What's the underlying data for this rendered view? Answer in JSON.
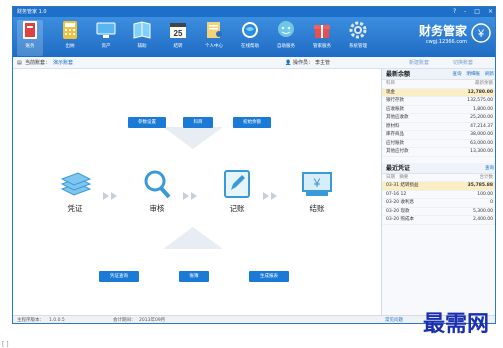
{
  "window": {
    "title": "财务管家 1.0",
    "controls": [
      "?",
      "-",
      "□",
      "×"
    ]
  },
  "toolbar": {
    "items": [
      {
        "label": "账务",
        "icon": "ledger-icon",
        "color": "#e04040"
      },
      {
        "label": "出纳",
        "icon": "calculator-icon",
        "color": "#f0c040"
      },
      {
        "label": "资产",
        "icon": "monitor-icon",
        "color": "#58b6f0"
      },
      {
        "label": "辅助",
        "icon": "book-icon",
        "color": "#7fd0ff"
      },
      {
        "label": "结转",
        "icon": "calendar-icon",
        "color": "#ffffff"
      },
      {
        "label": "个人中心",
        "icon": "user-doc-icon",
        "color": "#f3d27a"
      },
      {
        "label": "在线帮助",
        "icon": "globe-icon",
        "color": "#2a8de0"
      },
      {
        "label": "自助服务",
        "icon": "chat-icon",
        "color": "#6fc7e8"
      },
      {
        "label": "管家服务",
        "icon": "gift-icon",
        "color": "#e65050"
      },
      {
        "label": "系统管理",
        "icon": "gear-icon",
        "color": "#dfe8f2"
      }
    ],
    "brand_name": "财务管家",
    "brand_url": "cwgj.12366.com"
  },
  "subbar": {
    "current_book_label": "当前账套：",
    "current_book": "演示账套",
    "operator_label": "操作员：",
    "operator": "李主管",
    "new_book": "新建账套",
    "switch_book": "切换账套"
  },
  "flow": {
    "top_buttons": [
      "参数设置",
      "科目",
      "初始余额"
    ],
    "nodes": [
      "凭证",
      "审核",
      "记账",
      "结账"
    ],
    "bottom_buttons": [
      "凭证查询",
      "账簿",
      "生成报表"
    ]
  },
  "balance": {
    "title": "最新余额",
    "links": [
      "查询",
      "明细账",
      "刷新"
    ],
    "col_subject": "科目",
    "col_balance": "最新余额",
    "rows": [
      {
        "name": "现金",
        "value": "12,780.00",
        "highlight": true
      },
      {
        "name": "银行存款",
        "value": "132,575.00"
      },
      {
        "name": "应收账款",
        "value": "1,800.00"
      },
      {
        "name": "其他应收款",
        "value": "25,200.00"
      },
      {
        "name": "原材料",
        "value": "47,214.37"
      },
      {
        "name": "库存商品",
        "value": "38,000.00"
      },
      {
        "name": "应付账款",
        "value": "63,000.00"
      },
      {
        "name": "其他应付款",
        "value": "13,300.00"
      }
    ]
  },
  "vouchers": {
    "title": "最近凭证",
    "link": "查询",
    "col_date": "日期",
    "col_summary": "摘要",
    "col_amount": "合计数",
    "rows": [
      {
        "date": "03-31",
        "summary": "结转损益",
        "amount": "35,785.88",
        "highlight": true
      },
      {
        "date": "07-16",
        "summary": "12",
        "amount": "100.00"
      },
      {
        "date": "03-20",
        "summary": "收利息",
        "amount": "0"
      },
      {
        "date": "03-20",
        "summary": "现款",
        "amount": "5,300.00"
      },
      {
        "date": "03-20",
        "summary": "购成本",
        "amount": "2,400.00"
      }
    ]
  },
  "status": {
    "version_label": "主程序版本：",
    "version": "1.0.0.5",
    "period_label": "会计期间：",
    "period": "2013年09月",
    "right_text": "常见问题"
  },
  "watermark": "最需网",
  "accent": "#1a7ad6"
}
